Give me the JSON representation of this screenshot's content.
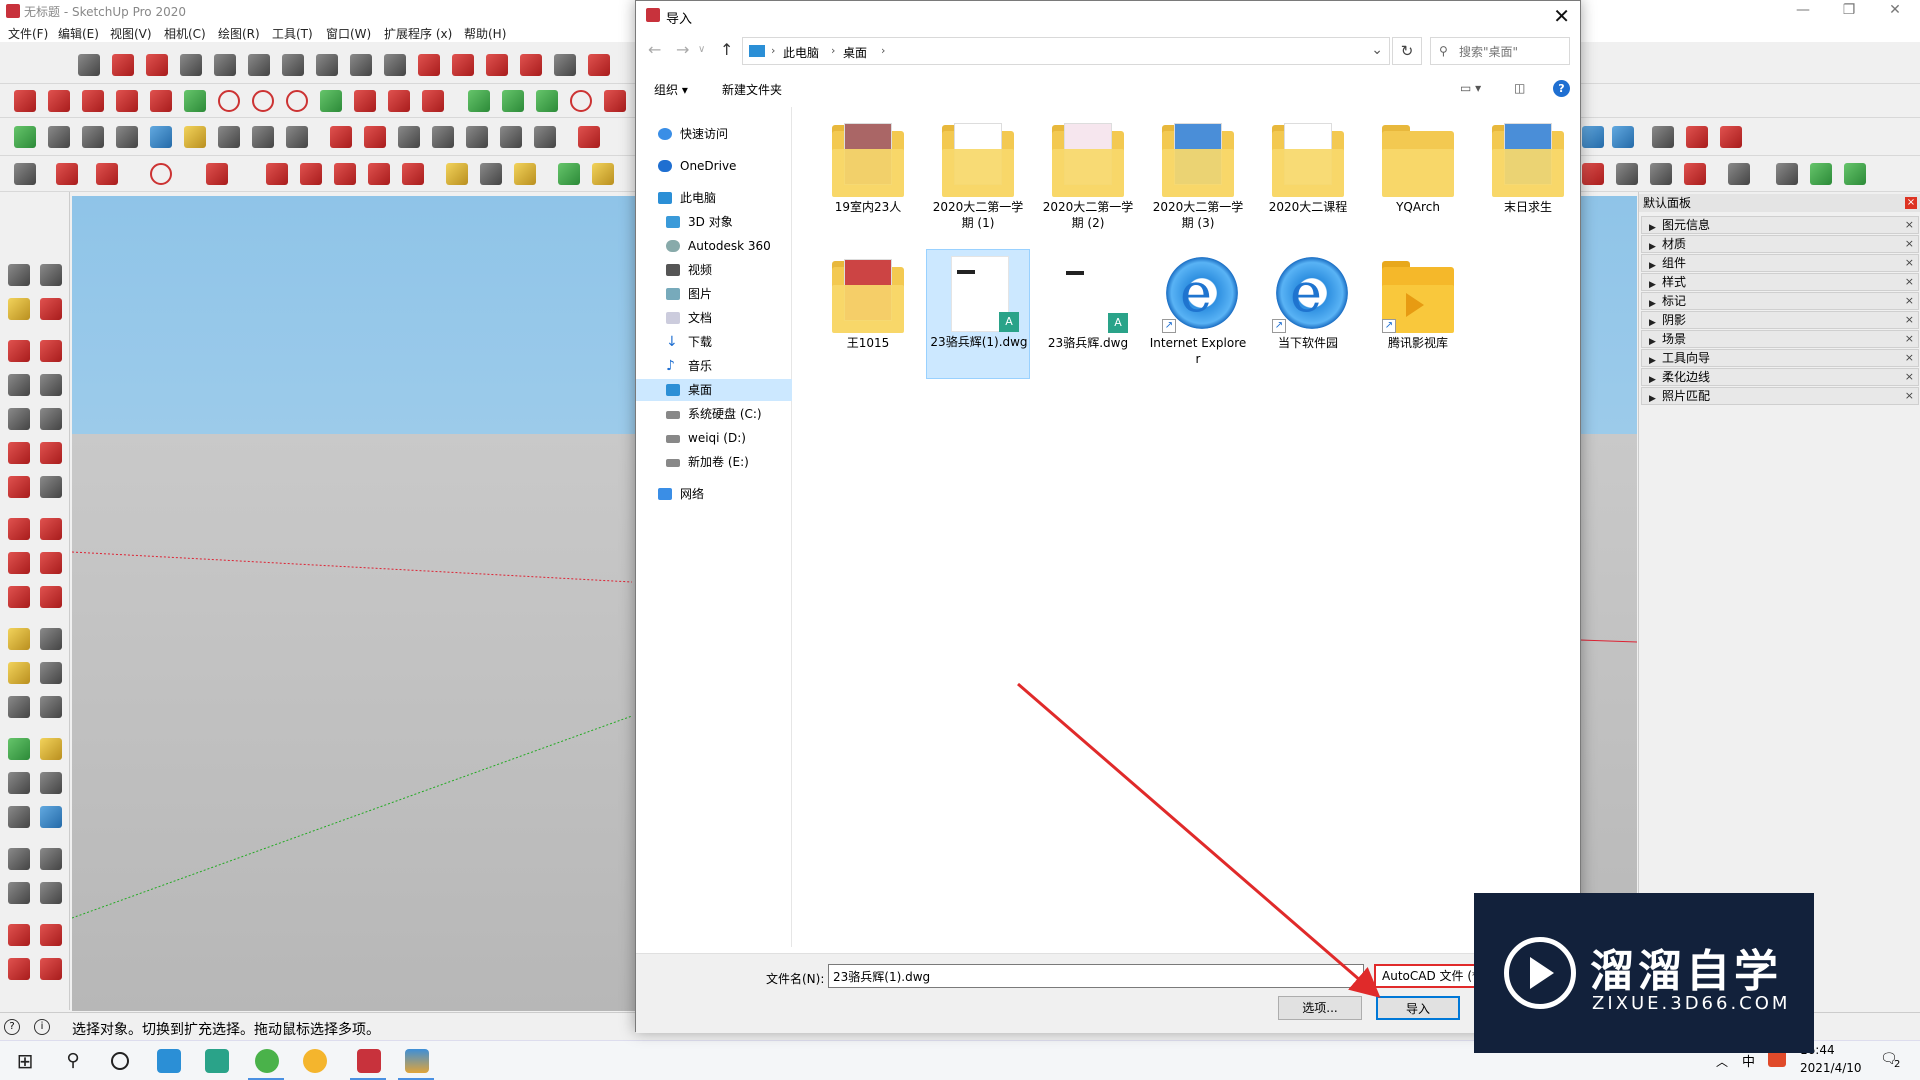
{
  "sketchup": {
    "title": "无标题 - SketchUp Pro 2020",
    "menu": [
      "文件(F)",
      "编辑(E)",
      "视图(V)",
      "相机(C)",
      "绘图(R)",
      "工具(T)",
      "窗口(W)",
      "扩展程序 (x)",
      "帮助(H)"
    ],
    "tray": {
      "title": "默认面板",
      "items": [
        "图元信息",
        "材质",
        "组件",
        "样式",
        "标记",
        "阴影",
        "场景",
        "工具向导",
        "柔化边线",
        "照片匹配"
      ]
    },
    "status_text": "选择对象。切换到扩充选择。拖动鼠标选择多项。"
  },
  "dialog": {
    "title": "导入",
    "breadcrumb": [
      "此电脑",
      "桌面"
    ],
    "search_placeholder": "搜索\"桌面\"",
    "commands": {
      "organize": "组织",
      "new_folder": "新建文件夹"
    },
    "nav_items": [
      "快速访问",
      "OneDrive",
      "此电脑",
      "3D 对象",
      "Autodesk 360",
      "视频",
      "图片",
      "文档",
      "下载",
      "音乐",
      "桌面",
      "系统硬盘 (C:)",
      "weiqi (D:)",
      "新加卷 (E:)",
      "网络"
    ],
    "files": [
      {
        "name": "19室内23人",
        "type": "folder"
      },
      {
        "name": "2020大二第一学期 (1)",
        "type": "folder"
      },
      {
        "name": "2020大二第一学期 (2)",
        "type": "folder"
      },
      {
        "name": "2020大二第一学期 (3)",
        "type": "folder"
      },
      {
        "name": "2020大二课程",
        "type": "folder"
      },
      {
        "name": "YQArch",
        "type": "folder"
      },
      {
        "name": "末日求生",
        "type": "folder"
      },
      {
        "name": "王1015",
        "type": "folder"
      },
      {
        "name": "23骆兵辉(1).dwg",
        "type": "dwg",
        "selected": true
      },
      {
        "name": "23骆兵辉.dwg",
        "type": "dwg"
      },
      {
        "name": "Internet Explorer",
        "type": "shortcut-ie"
      },
      {
        "name": "当下软件园",
        "type": "shortcut-ie"
      },
      {
        "name": "腾讯影视库",
        "type": "shortcut-video"
      }
    ],
    "filename_label": "文件名(N):",
    "filename_value": "23骆兵辉(1).dwg",
    "filter_value": "AutoCAD 文件 (*",
    "options_button": "选项...",
    "import_button": "导入"
  },
  "taskbar": {
    "time": "16:44",
    "date": "2021/4/10",
    "notifications": "2"
  },
  "watermark": {
    "brand": "溜溜自学",
    "url": "ZIXUE.3D66.COM"
  }
}
